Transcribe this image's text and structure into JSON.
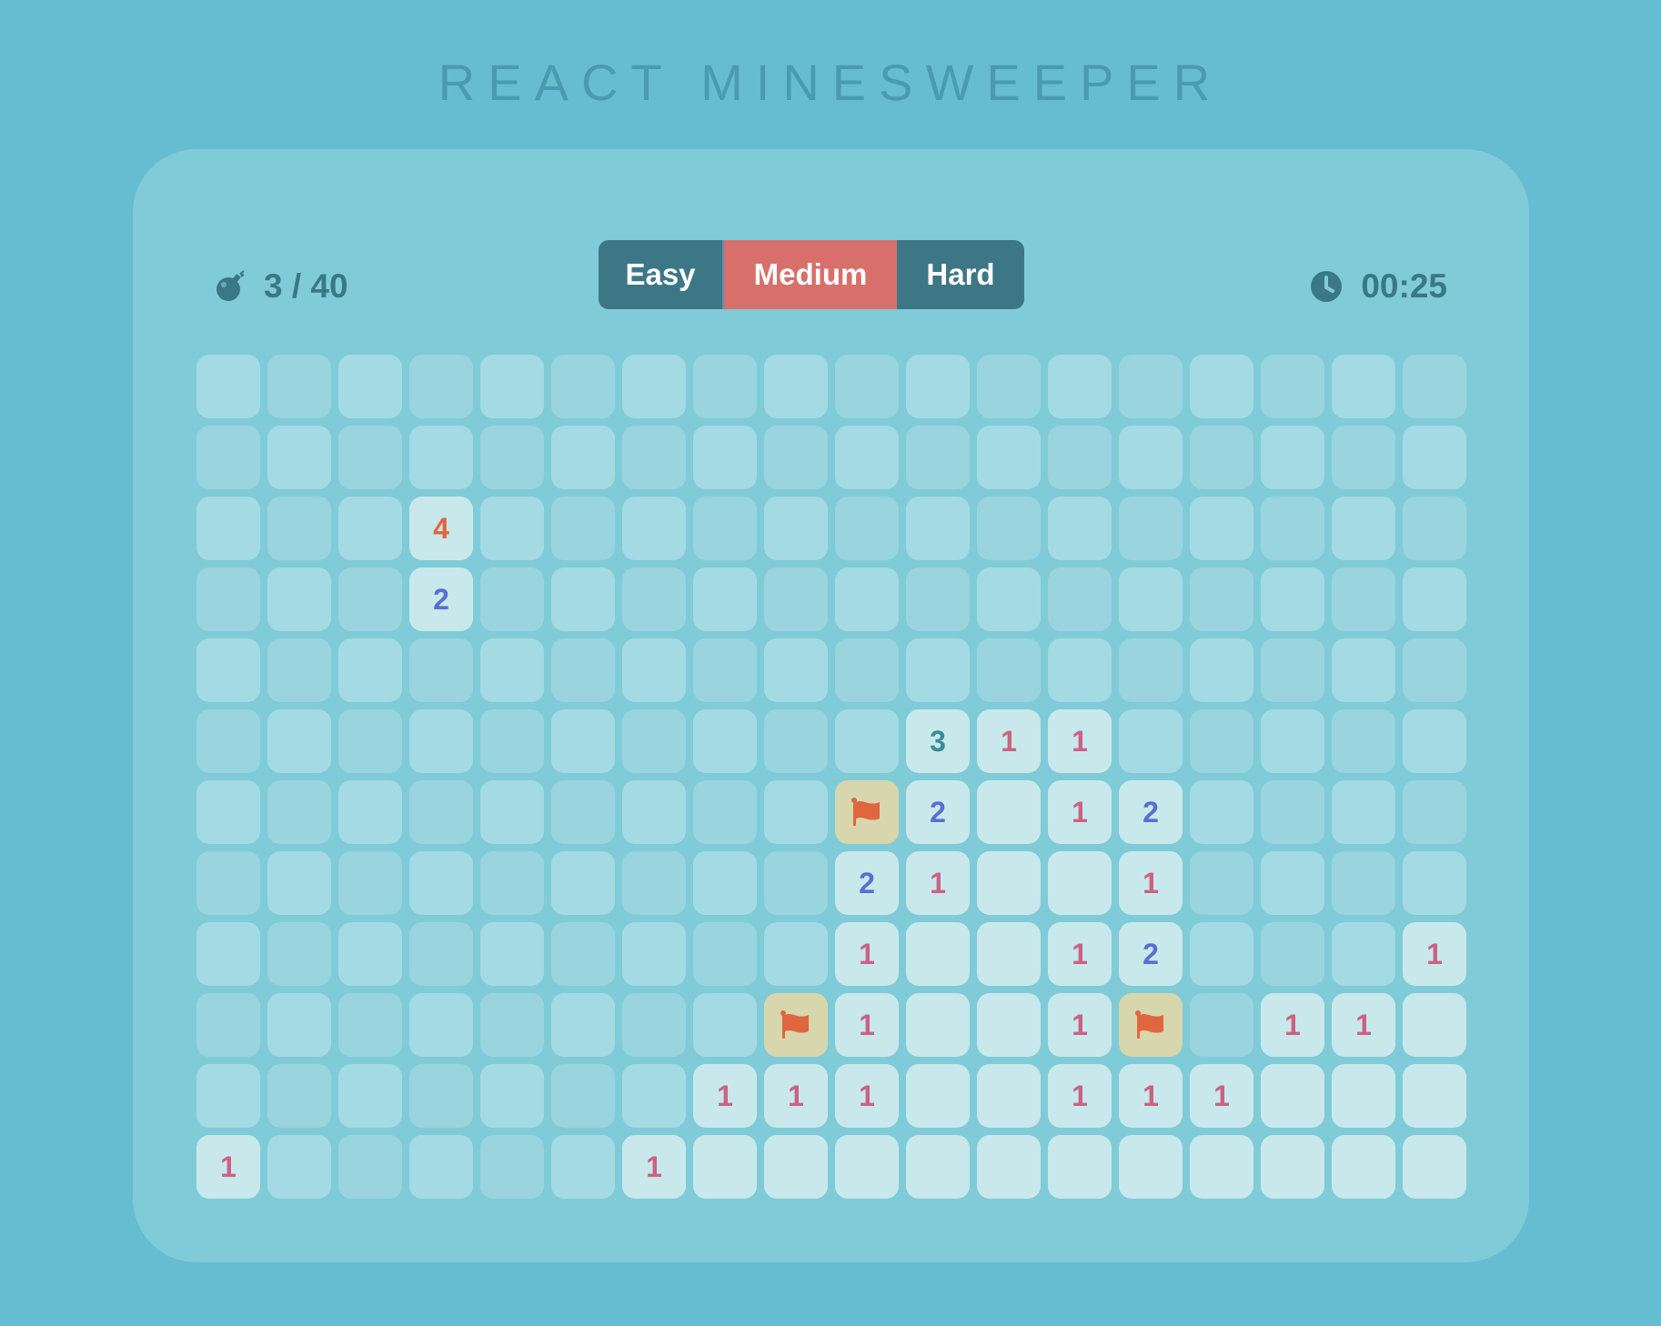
{
  "title": "REACT MINESWEEPER",
  "mines": {
    "icon": "bomb-icon",
    "text": "3 / 40"
  },
  "timer": {
    "icon": "clock-icon",
    "text": "00:25"
  },
  "difficulty": {
    "options": [
      "Easy",
      "Medium",
      "Hard"
    ],
    "selected": "Medium"
  },
  "colors": {
    "background": "#66bdd1",
    "panel": "#80cbd8",
    "active_button": "#d76f6b",
    "button": "#3d7785",
    "flag": "#e0663f"
  },
  "board": {
    "legend": "H = hidden cell, E = revealed empty cell, F = flagged cell, digit = revealed cell with adjacent-mine count",
    "rows": [
      [
        "H",
        "H",
        "H",
        "H",
        "H",
        "H",
        "H",
        "H",
        "H",
        "H",
        "H",
        "H",
        "H",
        "H",
        "H",
        "H",
        "H",
        "H"
      ],
      [
        "H",
        "H",
        "H",
        "H",
        "H",
        "H",
        "H",
        "H",
        "H",
        "H",
        "H",
        "H",
        "H",
        "H",
        "H",
        "H",
        "H",
        "H"
      ],
      [
        "H",
        "H",
        "H",
        "4",
        "H",
        "H",
        "H",
        "H",
        "H",
        "H",
        "H",
        "H",
        "H",
        "H",
        "H",
        "H",
        "H",
        "H"
      ],
      [
        "H",
        "H",
        "H",
        "2",
        "H",
        "H",
        "H",
        "H",
        "H",
        "H",
        "H",
        "H",
        "H",
        "H",
        "H",
        "H",
        "H",
        "H"
      ],
      [
        "H",
        "H",
        "H",
        "H",
        "H",
        "H",
        "H",
        "H",
        "H",
        "H",
        "H",
        "H",
        "H",
        "H",
        "H",
        "H",
        "H",
        "H"
      ],
      [
        "H",
        "H",
        "H",
        "H",
        "H",
        "H",
        "H",
        "H",
        "H",
        "H",
        "3",
        "1",
        "1",
        "H",
        "H",
        "H",
        "H",
        "H"
      ],
      [
        "H",
        "H",
        "H",
        "H",
        "H",
        "H",
        "H",
        "H",
        "H",
        "F",
        "2",
        "E",
        "1",
        "2",
        "H",
        "H",
        "H",
        "H"
      ],
      [
        "H",
        "H",
        "H",
        "H",
        "H",
        "H",
        "H",
        "H",
        "H",
        "2",
        "1",
        "E",
        "E",
        "1",
        "H",
        "H",
        "H",
        "H"
      ],
      [
        "H",
        "H",
        "H",
        "H",
        "H",
        "H",
        "H",
        "H",
        "H",
        "1",
        "E",
        "E",
        "1",
        "2",
        "H",
        "H",
        "H",
        "1"
      ],
      [
        "H",
        "H",
        "H",
        "H",
        "H",
        "H",
        "H",
        "H",
        "F",
        "1",
        "E",
        "E",
        "1",
        "F",
        "H",
        "1",
        "1",
        "E"
      ],
      [
        "H",
        "H",
        "H",
        "H",
        "H",
        "H",
        "H",
        "1",
        "1",
        "1",
        "E",
        "E",
        "1",
        "1",
        "1",
        "E",
        "E",
        "E"
      ],
      [
        "1",
        "H",
        "H",
        "H",
        "H",
        "H",
        "1",
        "E",
        "E",
        "E",
        "E",
        "E",
        "E",
        "E",
        "E",
        "E",
        "E",
        "E"
      ]
    ]
  }
}
